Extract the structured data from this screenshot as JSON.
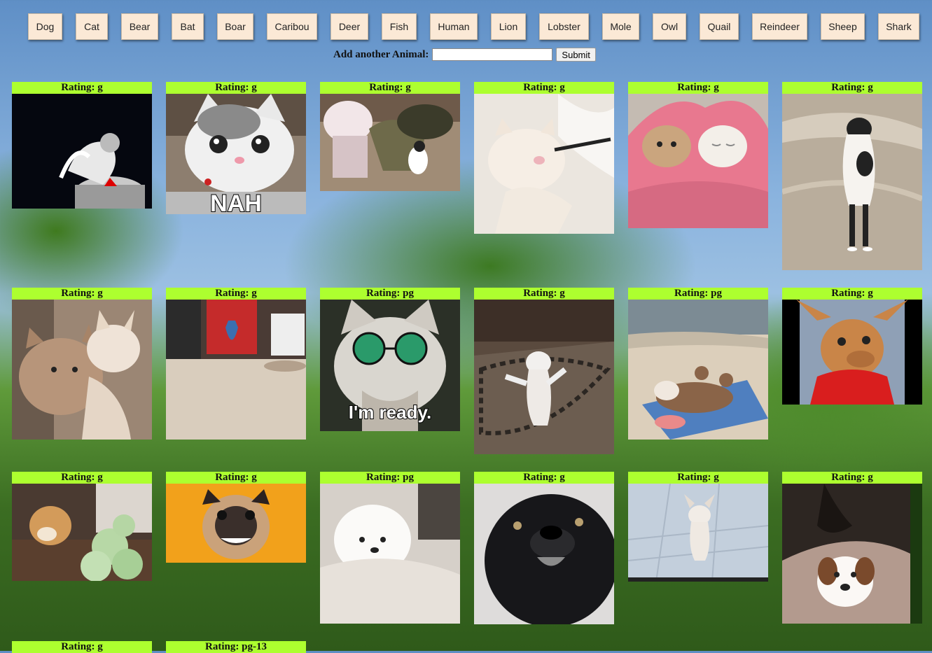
{
  "animal_buttons": [
    "Dog",
    "Cat",
    "Bear",
    "Bat",
    "Boar",
    "Caribou",
    "Deer",
    "Fish",
    "Human",
    "Lion",
    "Lobster",
    "Mole",
    "Owl",
    "Quail",
    "Reindeer",
    "Sheep",
    "Shark"
  ],
  "add_form": {
    "label": "Add another Animal:",
    "input_value": "",
    "submit_label": "Submit"
  },
  "gifs": [
    {
      "rating": "Rating: g",
      "caption": "",
      "subject": "cat-trashcan-icon"
    },
    {
      "rating": "Rating: g",
      "caption": "NAH",
      "subject": "cat-face-icon"
    },
    {
      "rating": "Rating: g",
      "caption": "",
      "subject": "cat-toddler-icon"
    },
    {
      "rating": "Rating: g",
      "caption": "",
      "subject": "cat-brush-icon"
    },
    {
      "rating": "Rating: g",
      "caption": "",
      "subject": "cats-blanket-icon"
    },
    {
      "rating": "Rating: g",
      "caption": "",
      "subject": "cat-standing-icon"
    },
    {
      "rating": "Rating: g",
      "caption": "",
      "subject": "cats-grooming-icon"
    },
    {
      "rating": "Rating: g",
      "caption": "",
      "subject": "cat-room-icon"
    },
    {
      "rating": "Rating: pg",
      "caption": "I'm ready.",
      "subject": "cat-sunglasses-icon"
    },
    {
      "rating": "Rating: g",
      "caption": "",
      "subject": "cat-dancing-icon"
    },
    {
      "rating": "Rating: pg",
      "caption": "",
      "subject": "dog-beach-icon"
    },
    {
      "rating": "Rating: g",
      "caption": "",
      "subject": "dog-sweater-icon"
    },
    {
      "rating": "Rating: g",
      "caption": "",
      "subject": "dog-cabbage-icon"
    },
    {
      "rating": "Rating: g",
      "caption": "",
      "subject": "pug-icon"
    },
    {
      "rating": "Rating: pg",
      "caption": "",
      "subject": "dog-fluffy-icon"
    },
    {
      "rating": "Rating: g",
      "caption": "",
      "subject": "dog-black-icon"
    },
    {
      "rating": "Rating: g",
      "caption": "",
      "subject": "chihuahua-dancing-icon"
    },
    {
      "rating": "Rating: g",
      "caption": "",
      "subject": "dog-bed-icon"
    },
    {
      "rating": "Rating: g",
      "caption": "",
      "subject": "gif-icon"
    },
    {
      "rating": "Rating: pg-13",
      "caption": "",
      "subject": "gif-icon"
    }
  ],
  "colors": {
    "rating_bar": "#adff2f",
    "button_bg": "#fbe9d6"
  }
}
